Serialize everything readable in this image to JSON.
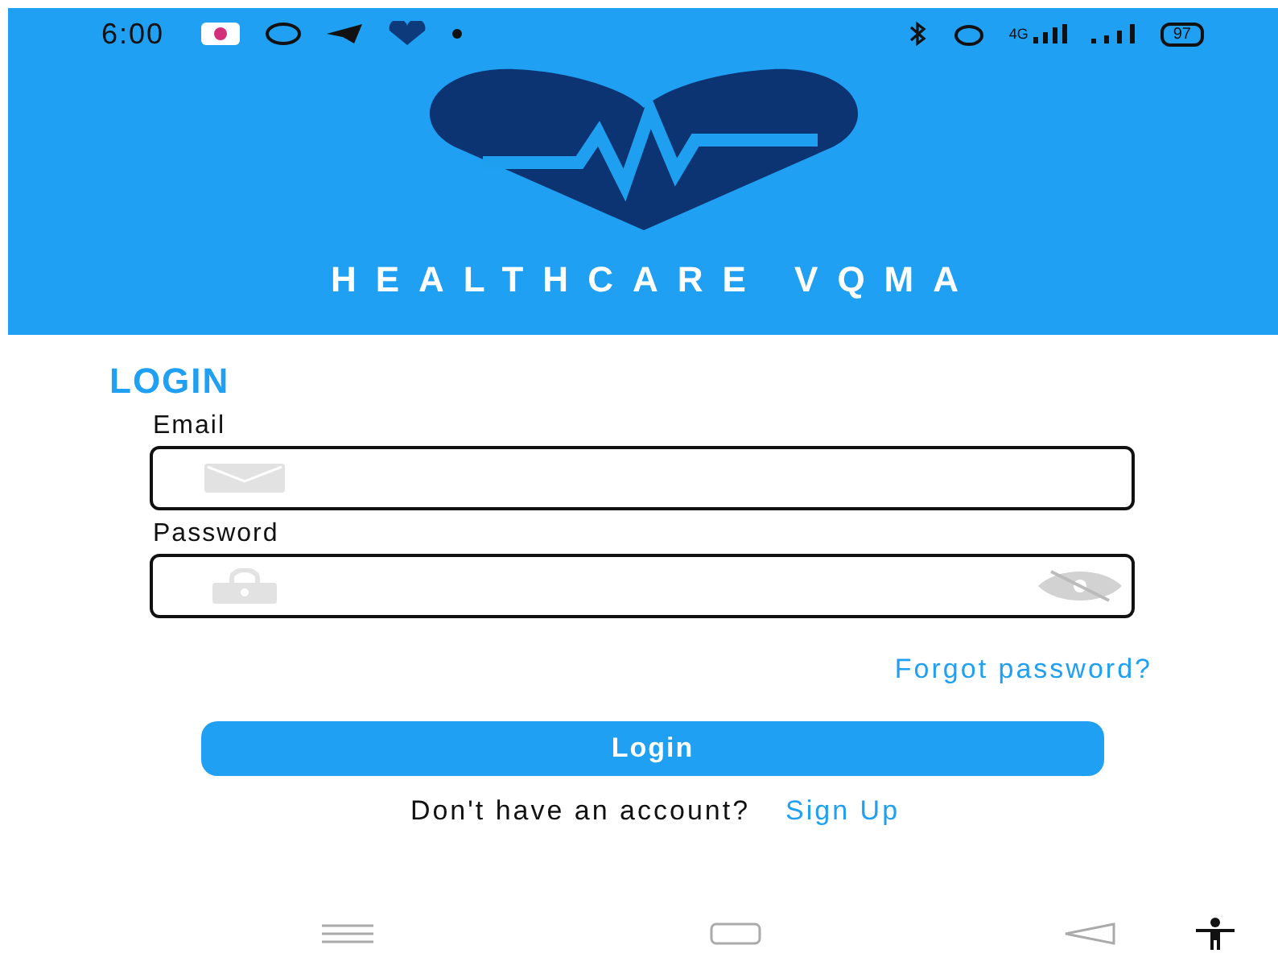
{
  "status_bar": {
    "time": "6:00",
    "network": "4G",
    "battery": "97"
  },
  "header": {
    "title": "HEALTHCARE VQMA"
  },
  "login": {
    "title": "LOGIN",
    "fields": [
      {
        "label": "Email",
        "kind": "email"
      },
      {
        "label": "Password",
        "kind": "password"
      }
    ],
    "forgot_link": "Forgot password?",
    "button": "Login",
    "signup_prompt": "Don't have an account?",
    "signup_link": "Sign Up"
  }
}
